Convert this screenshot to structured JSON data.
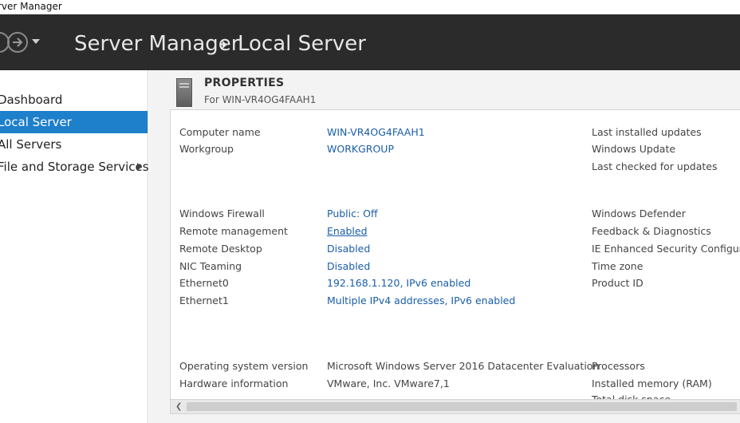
{
  "window": {
    "title": "Server Manager"
  },
  "header": {
    "app_name": "Server Manager",
    "page_name": "Local Server"
  },
  "sidebar": {
    "items": [
      {
        "label": "Dashboard"
      },
      {
        "label": "Local Server"
      },
      {
        "label": "All Servers"
      },
      {
        "label": "File and Storage Services"
      }
    ]
  },
  "properties": {
    "title": "PROPERTIES",
    "subtitle": "For WIN-VR4OG4FAAH1",
    "left_rows": [
      {
        "label": "Computer name",
        "value": "WIN-VR4OG4FAAH1"
      },
      {
        "label": "Workgroup",
        "value": "WORKGROUP"
      },
      {
        "label": "Windows Firewall",
        "value": "Public: Off"
      },
      {
        "label": "Remote management",
        "value": "Enabled"
      },
      {
        "label": "Remote Desktop",
        "value": "Disabled"
      },
      {
        "label": "NIC Teaming",
        "value": "Disabled"
      },
      {
        "label": "Ethernet0",
        "value": "192.168.1.120, IPv6 enabled"
      },
      {
        "label": "Ethernet1",
        "value": "Multiple IPv4 addresses, IPv6 enabled"
      },
      {
        "label": "Operating system version",
        "value": "Microsoft Windows Server 2016 Datacenter Evaluation"
      },
      {
        "label": "Hardware information",
        "value": "VMware, Inc. VMware7,1"
      }
    ],
    "right_labels": [
      "Last installed updates",
      "Windows Update",
      "Last checked for updates",
      "Windows Defender",
      "Feedback & Diagnostics",
      "IE Enhanced Security Configuratio",
      "Time zone",
      "Product ID",
      "Processors",
      "Installed memory (RAM)",
      "Total disk space"
    ]
  },
  "colors": {
    "header_bg": "#2b2b2b",
    "sidebar_active": "#1e7fcb",
    "link": "#1a5ea8"
  }
}
